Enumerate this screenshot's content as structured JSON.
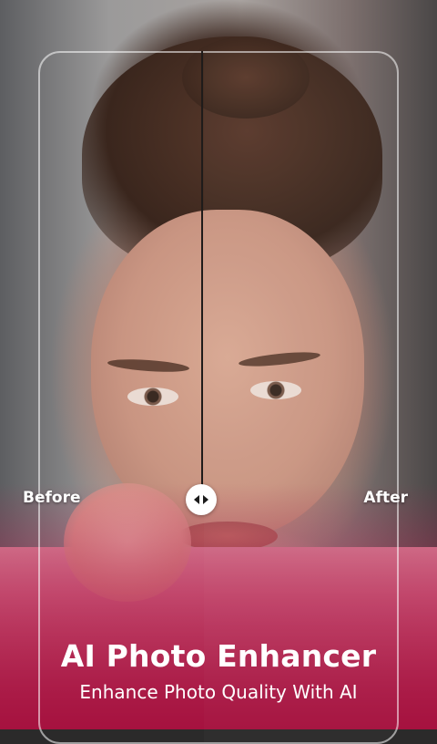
{
  "compare": {
    "before_label": "Before",
    "after_label": "After",
    "handle_icon": "compare-arrows-icon"
  },
  "promo": {
    "title": "AI Photo Enhancer",
    "subtitle": "Enhance Photo Quality With AI"
  },
  "colors": {
    "brand_gradient_end": "#a6123f",
    "handle_bg": "#ffffff",
    "text": "#ffffff"
  }
}
